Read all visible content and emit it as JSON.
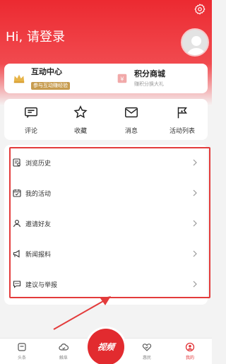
{
  "header": {
    "greeting": "Hi, 请登录"
  },
  "quick_cards": [
    {
      "title": "互动中心",
      "badge": "参与互动赚经验"
    },
    {
      "title": "积分商城",
      "sub": "赚积分换大礼"
    }
  ],
  "categories": [
    {
      "label": "评论",
      "icon": "comment-icon"
    },
    {
      "label": "收藏",
      "icon": "star-icon"
    },
    {
      "label": "消息",
      "icon": "mail-icon"
    },
    {
      "label": "活动列表",
      "icon": "flag-icon"
    }
  ],
  "menu": [
    {
      "label": "浏览历史",
      "icon": "history-icon"
    },
    {
      "label": "我的活动",
      "icon": "calendar-icon"
    },
    {
      "label": "邀请好友",
      "icon": "user-icon"
    },
    {
      "label": "新闻报料",
      "icon": "megaphone-icon"
    },
    {
      "label": "建议与举报",
      "icon": "feedback-icon"
    }
  ],
  "tabbar": [
    {
      "label": "头条",
      "icon": "headline-icon"
    },
    {
      "label": "触阜",
      "icon": "cloud-icon"
    },
    {
      "label": "视频",
      "icon": "video-icon"
    },
    {
      "label": "惠民",
      "icon": "heart-handshake-icon"
    },
    {
      "label": "我的",
      "icon": "profile-icon"
    }
  ],
  "colors": {
    "brand_red": "#e22b2f",
    "highlight": "#e33b3b",
    "gold": "#c79c4f"
  }
}
